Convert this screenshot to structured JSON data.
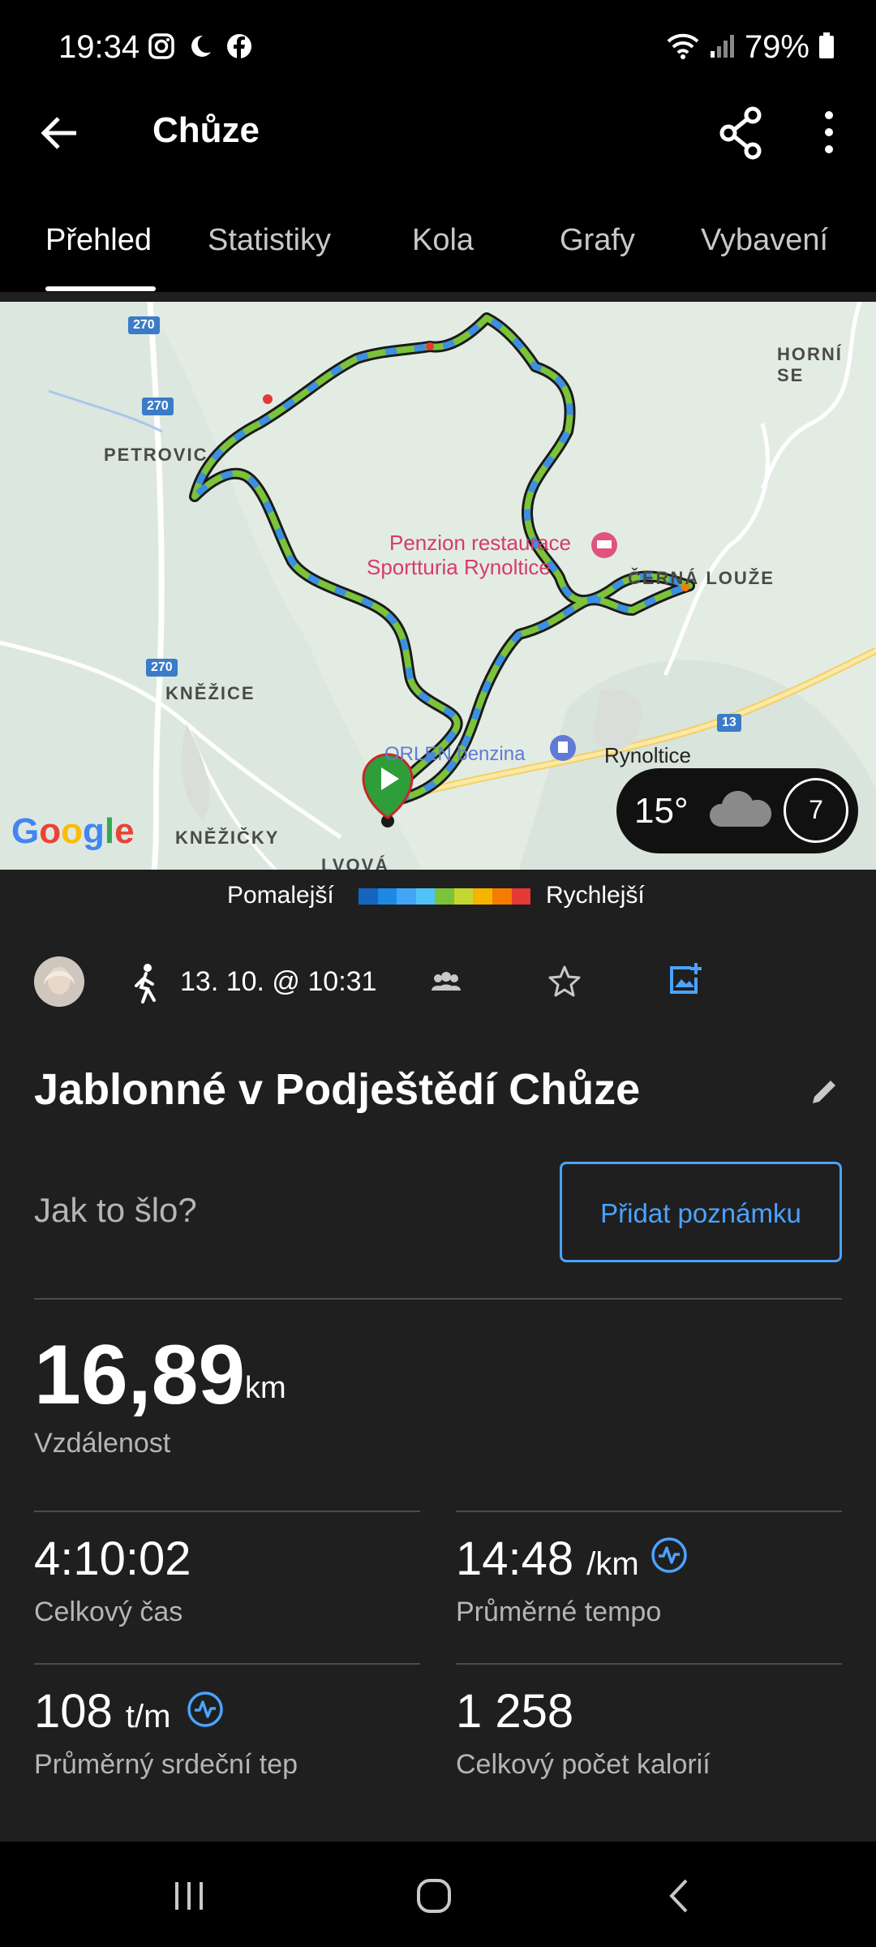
{
  "status_bar": {
    "time": "19:34",
    "battery": "79%",
    "icons": [
      "instagram-icon",
      "moon-icon",
      "facebook-icon",
      "wifi-icon",
      "signal-icon",
      "battery-icon"
    ]
  },
  "app_bar": {
    "title": "Chůze"
  },
  "tabs": [
    {
      "label": "Přehled",
      "active": true
    },
    {
      "label": "Statistiky",
      "active": false
    },
    {
      "label": "Kola",
      "active": false
    },
    {
      "label": "Grafy",
      "active": false
    },
    {
      "label": "Vybavení",
      "active": false
    }
  ],
  "map": {
    "places": {
      "horni": "HORNÍ SE",
      "petrovice": "PETROVIC",
      "cerna_louze": "ČERNÁ LOUŽE",
      "knezice": "KNĚŽICE",
      "knezicky": "KNĚŽIČKY",
      "lvova": "LVOVÁ",
      "rynoltice": "Rynoltice",
      "orlen": "ORLEN benzina"
    },
    "poi": {
      "line1": "Penzion restaurace",
      "line2": "Sportturia Rynoltice"
    },
    "road_numbers": [
      "270",
      "270",
      "270",
      "13"
    ],
    "logo": "Google",
    "weather": {
      "temperature": "15°",
      "badge": "7"
    }
  },
  "legend": {
    "slow": "Pomalejší",
    "fast": "Rychlejší",
    "colors": [
      "#1565c0",
      "#1e88e5",
      "#42a5f5",
      "#4fc3f7",
      "#7cc23a",
      "#c6d631",
      "#f4b400",
      "#f57c00",
      "#e53935"
    ]
  },
  "activity": {
    "date": "13. 10. @ 10:31",
    "title": "Jablonné v Podještědí Chůze",
    "notes_prompt": "Jak to šlo?",
    "add_note_label": "Přidat poznámku"
  },
  "stats": {
    "distance": {
      "value": "16,89",
      "unit": "km",
      "label": "Vzdálenost"
    },
    "total_time": {
      "value": "4:10:02",
      "label": "Celkový čas"
    },
    "avg_pace": {
      "value": "14:48",
      "unit": "/km",
      "label": "Průměrné tempo"
    },
    "avg_hr": {
      "value": "108",
      "unit": "t/m",
      "label": "Průměrný srdeční tep"
    },
    "calories": {
      "value": "1 258",
      "label": "Celkový počet kalorií"
    }
  },
  "accent_color": "#4aa3ff"
}
